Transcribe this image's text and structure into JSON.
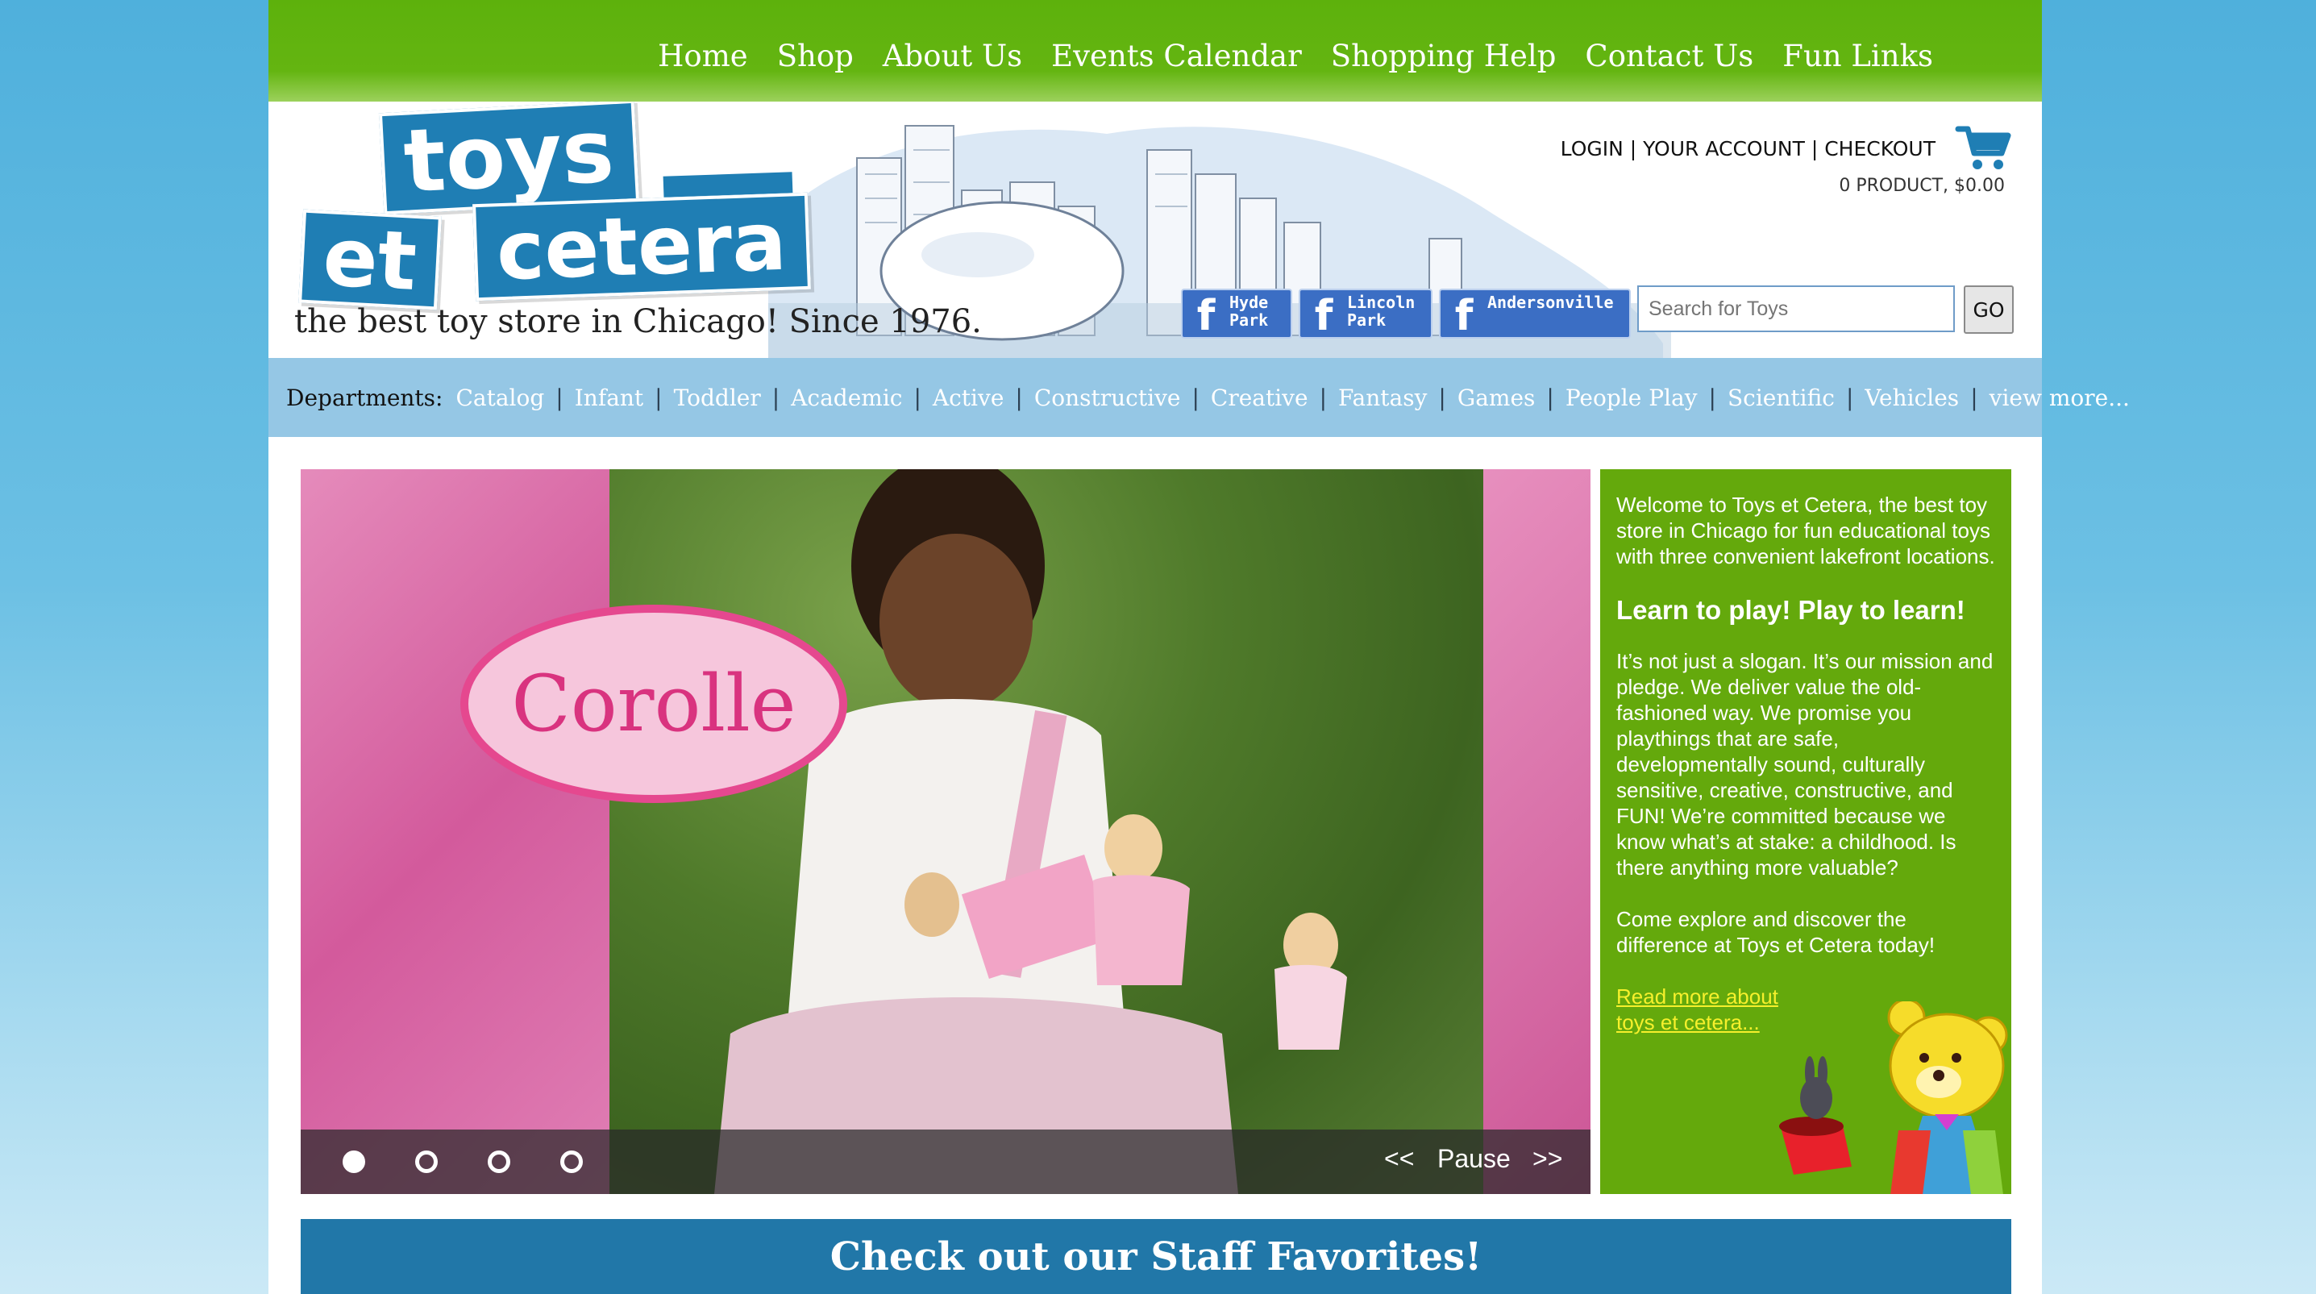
{
  "nav": {
    "items": [
      "Home",
      "Shop",
      "About Us",
      "Events Calendar",
      "Shopping Help",
      "Contact Us",
      "Fun Links"
    ]
  },
  "logo": {
    "line1": "toys",
    "line2a": "et",
    "line2b": "cetera",
    "tagline": "the best toy store in Chicago! Since 1976."
  },
  "account": {
    "login": "LOGIN",
    "your_account": "YOUR ACCOUNT",
    "checkout": "CHECKOUT",
    "separator": " | ",
    "cart_summary": "0 PRODUCT, $0.00",
    "cart_icon": "shopping-cart-icon"
  },
  "facebook": [
    {
      "line1": "Hyde",
      "line2": "Park"
    },
    {
      "line1": "Lincoln",
      "line2": "Park"
    },
    {
      "line1": "Andersonville",
      "line2": ""
    }
  ],
  "search": {
    "placeholder": "Search for Toys",
    "button": "GO"
  },
  "departments": {
    "label": "Departments:",
    "items": [
      "Catalog",
      "Infant",
      "Toddler",
      "Academic",
      "Active",
      "Constructive",
      "Creative",
      "Fantasy",
      "Games",
      "People Play",
      "Scientific",
      "Vehicles",
      "view more..."
    ]
  },
  "slideshow": {
    "brand": "Corolle",
    "prev": "<<",
    "pause": "Pause",
    "next": ">>",
    "dots": 4,
    "active_dot": 0
  },
  "welcome": {
    "intro": "Welcome to Toys et Cetera, the best toy store in Chicago for fun educational toys with three convenient lakefront locations.",
    "heading": "Learn to play! Play to learn!",
    "body": "It’s not just a slogan.  It’s our mission and pledge.  We deliver value the old-fashioned way. We promise you playthings that are safe, developmentally sound, culturally sensitive, creative, constructive, and FUN! We’re committed because we know what’s at stake: a childhood.  Is there anything more valuable?",
    "closing": "Come explore and discover the difference at Toys et Cetera today!",
    "read_more": "Read more about toys et cetera..."
  },
  "staff": {
    "title": "Check out our Staff Favorites!"
  },
  "colors": {
    "nav_green": "#5db10c",
    "brand_blue": "#1f7eb4",
    "dept_bar": "#95c7e5",
    "panel_green": "#64a90c",
    "link_yellow": "#f6f02c"
  }
}
